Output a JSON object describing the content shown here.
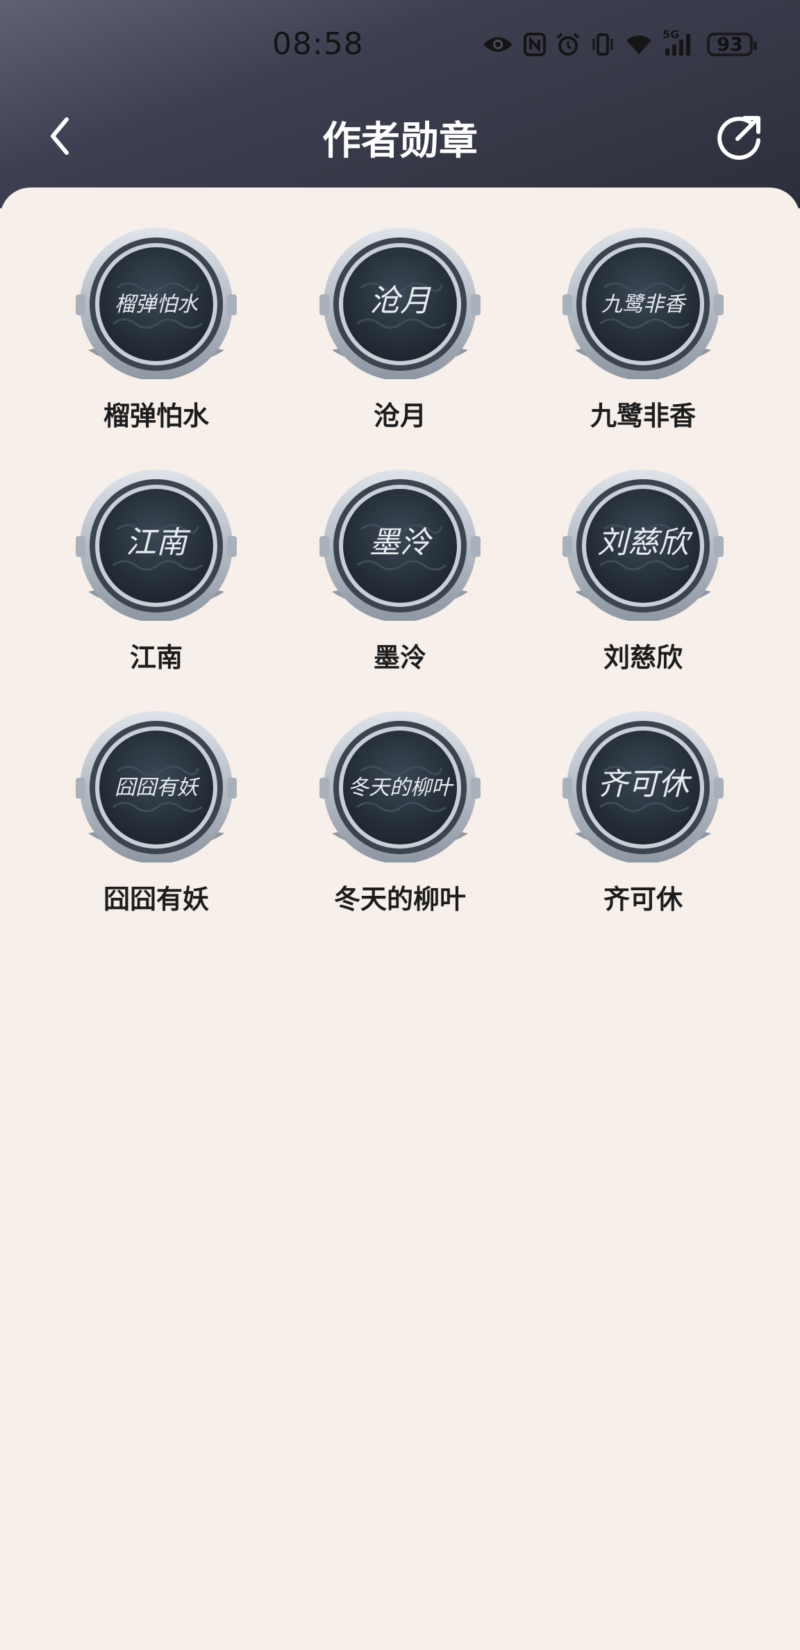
{
  "status_bar": {
    "time": "08:58",
    "network": "5G",
    "battery": "93",
    "icons": [
      "eye-icon",
      "nfc-icon",
      "alarm-icon",
      "vibrate-icon",
      "wifi-icon",
      "signal-icon",
      "battery-icon"
    ]
  },
  "header": {
    "title": "作者勋章",
    "back_icon": "chevron-left-icon",
    "share_icon": "share-icon"
  },
  "colors": {
    "header_start": "#5f6274",
    "header_end": "#2c2e3a",
    "background": "#f6efea",
    "medal_face": "#2b3540",
    "medal_rim": "#b9c0c8"
  },
  "badges": [
    {
      "name": "榴弹怕水",
      "signature": "榴弹怕水"
    },
    {
      "name": "沧月",
      "signature": "沧月"
    },
    {
      "name": "九鹭非香",
      "signature": "九鹭非香"
    },
    {
      "name": "江南",
      "signature": "江南"
    },
    {
      "name": "墨泠",
      "signature": "墨泠"
    },
    {
      "name": "刘慈欣",
      "signature": "刘慈欣"
    },
    {
      "name": "囧囧有妖",
      "signature": "囧囧有妖"
    },
    {
      "name": "冬天的柳叶",
      "signature": "冬天的柳叶"
    },
    {
      "name": "齐可休",
      "signature": "齐可休"
    }
  ]
}
